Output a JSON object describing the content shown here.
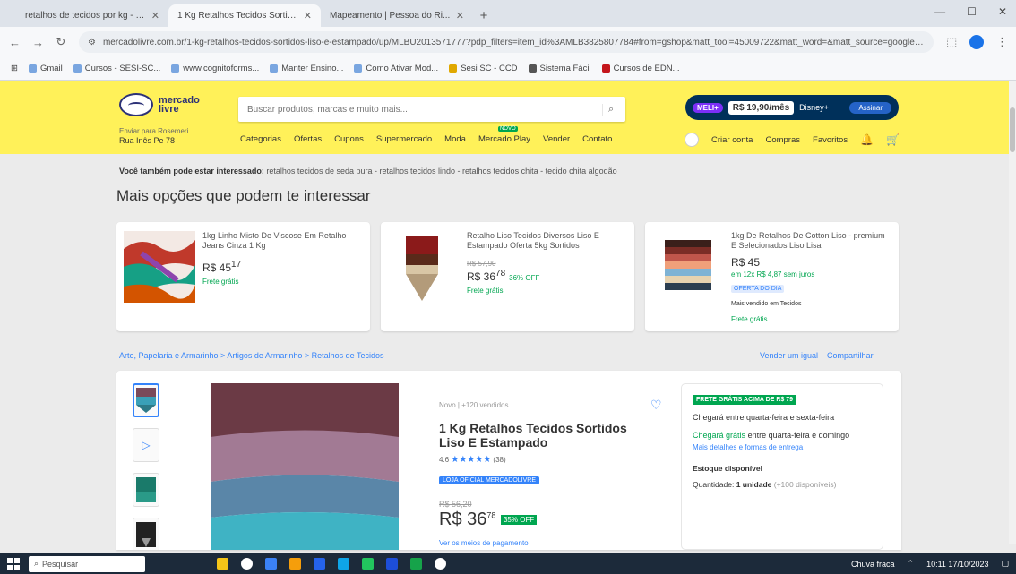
{
  "browser": {
    "tabs": [
      {
        "title": "retalhos de tecidos por kg - Pe...",
        "active": false,
        "color": "#e0a800"
      },
      {
        "title": "1 Kg Retalhos Tecidos Sortidos L...",
        "active": true,
        "color": "#fff159"
      },
      {
        "title": "Mapeamento | Pessoa do Ri...",
        "active": false,
        "color": "#1a4a8a"
      }
    ],
    "new_tab": "+",
    "window_controls": [
      "—",
      "☐",
      "✕"
    ],
    "url": "mercadolivre.com.br/1-kg-retalhos-tecidos-sortidos-liso-e-estampado/up/MLBU2013571777?pdp_filters=item_id%3AMLB3825807784#from=gshop&matt_tool=45009722&matt_word=&matt_source=google&matt_campaign_id=...",
    "bookmarks": [
      "Gmail",
      "Cursos - SESI-SC...",
      "www.cognitoforms...",
      "Manter Ensino...",
      "Como Ativar Mod...",
      "Sesi SC - CCD",
      "Sistema Fácil",
      "Cursos de EDN..."
    ]
  },
  "ml": {
    "logo_line1": "mercado",
    "logo_line2": "livre",
    "search_placeholder": "Buscar produtos, marcas e muito mais...",
    "promo": {
      "pill": "MELI+",
      "price": "R$ 19,90/mês",
      "brand": "Disney+",
      "button": "Assinar"
    },
    "location_label": "Enviar para Rosemeri",
    "location_value": "Rua Inês Pe 78",
    "menu": [
      "Categorias",
      "Ofertas",
      "Cupons",
      "Supermercado",
      "Moda",
      "Mercado Play",
      "Vender",
      "Contato"
    ],
    "user_menu": [
      "Criar conta",
      "Compras",
      "Favoritos"
    ]
  },
  "also": {
    "bold": "Você também pode estar interessado:",
    "text": "retalhos tecidos de seda pura - retalhos tecidos lindo - retalhos tecidos chita - tecido chita algodão"
  },
  "section_title": "Mais opções que podem te interessar",
  "cards": [
    {
      "title": "1kg Linho Misto De Viscose Em Retalho Jeans Cinza 1 Kg",
      "old": "",
      "price": "R$ 45",
      "cents": "17",
      "discount": "",
      "free": "Frete grátis",
      "badge": "",
      "misc": ""
    },
    {
      "title": "Retalho Liso Tecidos Diversos Liso E Estampado Oferta 5kg Sortidos",
      "old": "R$ 57,90",
      "price": "R$ 36",
      "cents": "78",
      "discount": "36% OFF",
      "free": "Frete grátis",
      "badge": "",
      "misc": ""
    },
    {
      "title": "1kg De Retalhos De Cotton Liso - premium E Selecionados Liso Lisa",
      "old": "",
      "price": "R$ 45",
      "cents": "",
      "discount": "",
      "free": "Frete grátis",
      "badge": "OFERTA DO DIA",
      "misc": "Mais vendido em Tecidos",
      "installment": "em 12x R$ 4,87 sem juros"
    }
  ],
  "breadcrumb": "Arte, Papelaria e Armarinho > Artigos de Armarinho > Retalhos de Tecidos",
  "crumb_right": [
    "Vender um igual",
    "Compartilhar"
  ],
  "product": {
    "condition": "Novo | +120 vendidos",
    "title": "1 Kg Retalhos Tecidos Sortidos Liso E Estampado",
    "rating_value": "4.6",
    "stars": "★★★★★",
    "rating_count": "(38)",
    "official": "LOJA OFICIAL MERCADOLIVRE",
    "old_price": "R$ 56,20",
    "price": "R$ 36",
    "cents": "78",
    "discount": "35% OFF",
    "installments": "Ver os meios de pagamento"
  },
  "buybox": {
    "tag": "FRETE GRÁTIS ACIMA DE R$ 79",
    "arrival": "Chegará entre quarta-feira e sexta-feira",
    "free_label": "Chegará grátis",
    "free_text": "entre quarta-feira e domingo",
    "link": "Mais detalhes e formas de entrega",
    "stock": "Estoque disponível",
    "qty_label": "Quantidade:",
    "qty_value": "1 unidade",
    "qty_muted": "(+100 disponíveis)"
  },
  "taskbar": {
    "search": "Pesquisar",
    "status": "Chuva fraca",
    "time": "10:11",
    "date": "17/10/2023"
  },
  "colors": {
    "ml_yellow": "#fff159",
    "ml_blue": "#3483fa",
    "ml_green": "#00a650",
    "taskbar": "#1c2a3a"
  }
}
